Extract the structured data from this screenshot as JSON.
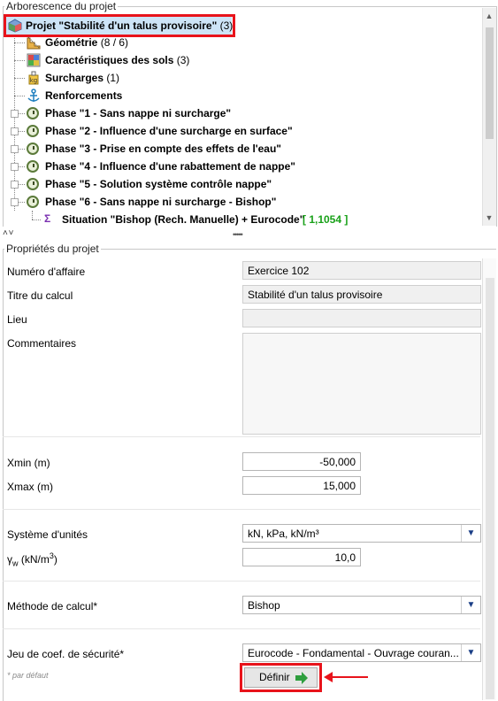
{
  "tree_panel": {
    "title": "Arborescence du projet",
    "root": {
      "label": "Projet \"Stabilité d'un talus provisoire\"",
      "count": "(3)"
    },
    "items": [
      {
        "label": "Géométrie",
        "suffix": "(8 / 6)",
        "icon": "geometry-icon"
      },
      {
        "label": "Caractéristiques des sols",
        "suffix": "(3)",
        "icon": "soil-icon"
      },
      {
        "label": "Surcharges",
        "suffix": "(1)",
        "icon": "surcharge-icon"
      },
      {
        "label": "Renforcements",
        "suffix": "",
        "icon": "anchor-icon"
      }
    ],
    "phases": [
      {
        "label": "Phase \"1 - Sans nappe ni surcharge\""
      },
      {
        "label": "Phase \"2 - Influence d'une surcharge en surface\""
      },
      {
        "label": "Phase \"3 - Prise en compte des effets de l'eau\""
      },
      {
        "label": "Phase \"4 - Influence d'une rabattement de nappe\""
      },
      {
        "label": "Phase \"5 - Solution système contrôle nappe\""
      },
      {
        "label": "Phase \"6 - Sans nappe ni surcharge - Bishop\""
      }
    ],
    "situation": {
      "label": "Situation \"Bishop (Rech. Manuelle) + Eurocode\"",
      "value": "[ 1,1054 ]",
      "value_color": "#19a119"
    }
  },
  "splitter": {
    "collapse_glyph": "˄ ˅",
    "grip": "•••••"
  },
  "properties": {
    "title": "Propriétés du projet",
    "numero_label": "Numéro d'affaire",
    "numero_value": "Exercice 102",
    "titre_label": "Titre du calcul",
    "titre_value": "Stabilité d'un talus provisoire",
    "lieu_label": "Lieu",
    "lieu_value": "",
    "commentaires_label": "Commentaires",
    "xmin_label": "Xmin (m)",
    "xmin_value": "-50,000",
    "xmax_label": "Xmax (m)",
    "xmax_value": "15,000",
    "unites_label": "Système d'unités",
    "unites_value": "kN, kPa, kN/m³",
    "gamma_label_main": "γ",
    "gamma_label_sub": "w",
    "gamma_label_rest": " (kN/m",
    "gamma_label_sup": "3",
    "gamma_label_end": ")",
    "gamma_value": "10,0",
    "methode_label": "Méthode de calcul*",
    "methode_value": "Bishop",
    "jeu_label": "Jeu de coef. de sécurité*",
    "jeu_value": "Eurocode - Fondamental - Ouvrage couran...",
    "footnote": "* par défaut",
    "definir_label": "Définir"
  },
  "colors": {
    "highlight_red": "#e8131b",
    "arrow_green": "#2e9e3e"
  }
}
